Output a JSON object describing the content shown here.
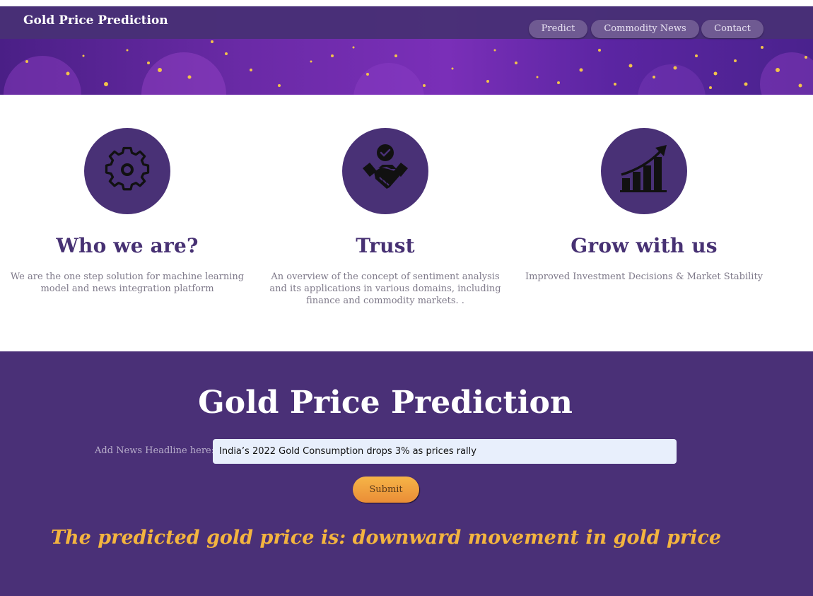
{
  "app": {
    "title": "Gold Price Prediction"
  },
  "nav": {
    "items": [
      {
        "label": "Predict"
      },
      {
        "label": "Commodity News"
      },
      {
        "label": "Contact"
      }
    ]
  },
  "features": [
    {
      "icon": "gear-icon",
      "title": "Who we are?",
      "description": "We are the one step solution for machine learning model and news integration platform"
    },
    {
      "icon": "handshake-icon",
      "title": "Trust",
      "description": "An overview of the concept of sentiment analysis and its applications in various domains, including finance and commodity markets. ."
    },
    {
      "icon": "growth-chart-icon",
      "title": "Grow with us",
      "description": "Improved Investment Decisions & Market Stability"
    }
  ],
  "prediction": {
    "title": "Gold Price Prediction",
    "input_label": "Add News Headline here:",
    "input_value": "India’s 2022 Gold Consumption drops 3% as prices rally",
    "submit_label": "Submit",
    "result_text": "The predicted gold price is: downward movement in gold price"
  },
  "colors": {
    "primary_purple": "#4a3077",
    "nav_pill": "#6f5a92",
    "gold_accent": "#f3b43f",
    "button_orange": "#ea8d37"
  }
}
